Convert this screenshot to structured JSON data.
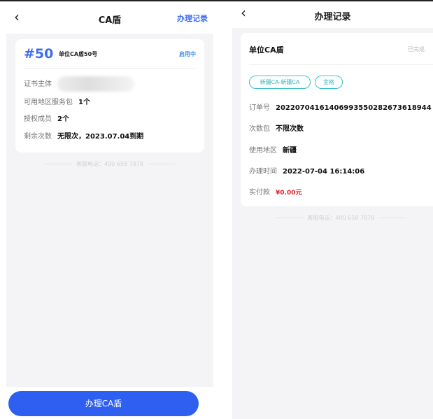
{
  "left": {
    "nav": {
      "title": "CA盾",
      "link": "办理记录"
    },
    "card": {
      "number": "#50",
      "name": "单位CA盾50号",
      "status": "启用中",
      "rows": [
        {
          "label": "证书主体",
          "value": ""
        },
        {
          "label": "可用地区服务包",
          "value": "1个"
        },
        {
          "label": "授权成员",
          "value": "2个"
        },
        {
          "label": "剩余次数",
          "value": "无限次，2023.07.04到期"
        }
      ]
    },
    "hotline": "客服电话：400 658 7878",
    "primary_button": "办理CA盾"
  },
  "right": {
    "nav": {
      "title": "办理记录"
    },
    "card": {
      "title": "单位CA盾",
      "status": "已完成",
      "tags": [
        "新疆CA-新疆CA",
        "金格"
      ],
      "rows": [
        {
          "label": "订单号",
          "value": "20220704161406993550282673618944"
        },
        {
          "label": "次数包",
          "value": "不限次数"
        },
        {
          "label": "使用地区",
          "value": "新疆"
        },
        {
          "label": "办理时间",
          "value": "2022-07-04 16:14:06"
        },
        {
          "label": "实付款",
          "value": "¥0.00元"
        }
      ]
    },
    "hotline": "客服电话：400 658 7878"
  },
  "colors": {
    "accent": "#3d6cf0",
    "button": "#2f5ff0",
    "tag": "#38c0c6",
    "price": "#e0242f"
  },
  "icons": {
    "back": "chevron-left-icon"
  }
}
